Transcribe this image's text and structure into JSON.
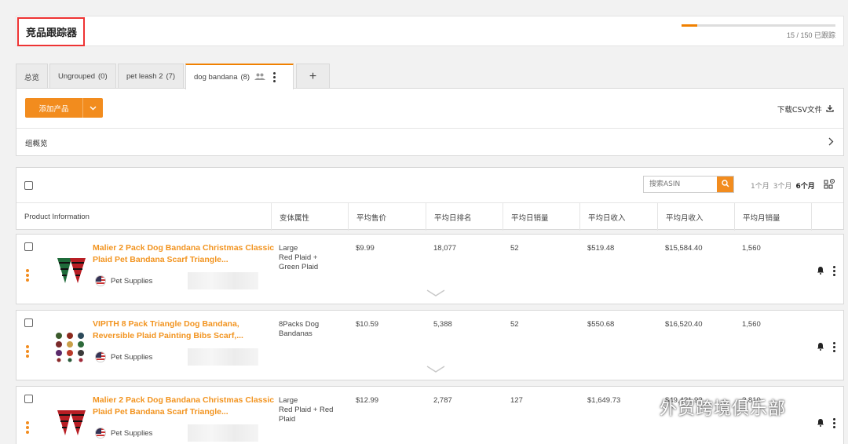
{
  "header": {
    "title": "竞品跟踪器",
    "tracking_text": "15 / 150 已跟踪",
    "tracked": 15,
    "limit": 150
  },
  "tabs": [
    {
      "label": "总览",
      "count": ""
    },
    {
      "label": "Ungrouped",
      "count": "(0)"
    },
    {
      "label": "pet leash 2",
      "count": "(7)"
    },
    {
      "label": "dog bandana",
      "count": "(8)"
    }
  ],
  "toolbar": {
    "add_label": "添加产品",
    "csv_label": "下载CSV文件",
    "overview_label": "组概览"
  },
  "search": {
    "placeholder": "搜索ASIN"
  },
  "periods": [
    "1个月",
    "3个月",
    "6个月"
  ],
  "columns": [
    "Product Information",
    "变体属性",
    "平均售价",
    "平均日排名",
    "平均日销量",
    "平均日收入",
    "平均月收入",
    "平均月销量"
  ],
  "rows": [
    {
      "title": "Malier 2 Pack Dog Bandana Christmas Classic Plaid Pet Bandana Scarf Triangle...",
      "category": "Pet Supplies",
      "variant": "Large\nRed Plaid +\nGreen Plaid",
      "price": "$9.99",
      "rank": "18,077",
      "daily_sales": "52",
      "daily_rev": "$519.48",
      "monthly_rev": "$15,584.40",
      "monthly_sales": "1,560"
    },
    {
      "title": "VIPITH 8 Pack Triangle Dog Bandana, Reversible Plaid Painting Bibs Scarf,...",
      "category": "Pet Supplies",
      "variant": "8Packs Dog\nBandanas",
      "price": "$10.59",
      "rank": "5,388",
      "daily_sales": "52",
      "daily_rev": "$550.68",
      "monthly_rev": "$16,520.40",
      "monthly_sales": "1,560"
    },
    {
      "title": "Malier 2 Pack Dog Bandana Christmas Classic Plaid Pet Bandana Scarf Triangle...",
      "category": "Pet Supplies",
      "variant": "Large\nRed Plaid + Red\nPlaid",
      "price": "$12.99",
      "rank": "2,787",
      "daily_sales": "127",
      "daily_rev": "$1,649.73",
      "monthly_rev": "$49,4?1.9?",
      "monthly_sales": "?,810"
    }
  ],
  "watermark": "外贸跨境俱乐部",
  "colors": {
    "accent": "#f28c1e",
    "title_link": "#f29420",
    "highlight_box": "#ee3333"
  }
}
